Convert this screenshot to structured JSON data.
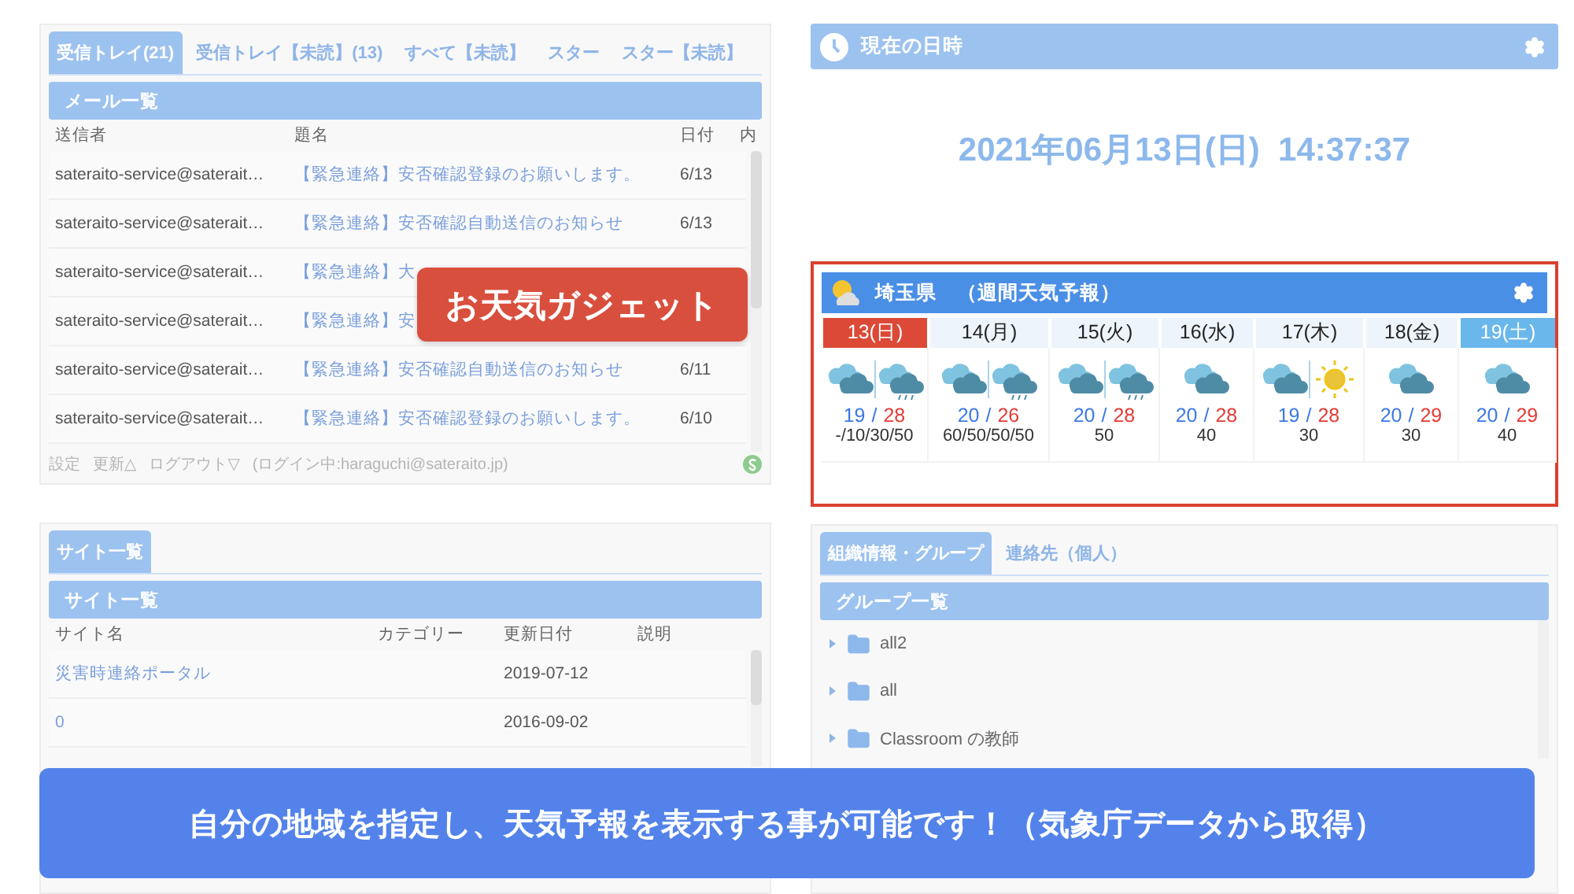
{
  "mail_panel": {
    "tabs": [
      {
        "label": "受信トレイ(21)",
        "selected": true
      },
      {
        "label": "受信トレイ【未読】(13)",
        "selected": false
      },
      {
        "label": "すべて【未読】",
        "selected": false
      },
      {
        "label": "スター",
        "selected": false
      },
      {
        "label": "スター【未読】",
        "selected": false
      }
    ],
    "header": "メール一覧",
    "columns": [
      "送信者",
      "題名",
      "日付",
      "内"
    ],
    "rows": [
      {
        "sender": "sateraito-service@saterait…",
        "subject": "【緊急連絡】安否確認登録のお願いします。",
        "date": "6/13"
      },
      {
        "sender": "sateraito-service@saterait…",
        "subject": "【緊急連絡】安否確認自動送信のお知らせ",
        "date": "6/13"
      },
      {
        "sender": "sateraito-service@saterait…",
        "subject": "【緊急連絡】大"
      },
      {
        "sender": "sateraito-service@saterait…",
        "subject": "【緊急連絡】安"
      },
      {
        "sender": "sateraito-service@saterait…",
        "subject": "【緊急連絡】安否確認自動送信のお知らせ",
        "date": "6/11"
      },
      {
        "sender": "sateraito-service@saterait…",
        "subject": "【緊急連絡】安否確認登録のお願いします。",
        "date": "6/10"
      }
    ],
    "footer": {
      "links": [
        "設定",
        "更新△",
        "ログアウト▽"
      ],
      "login": "(ログイン中:haraguchi@sateraito.jp)"
    }
  },
  "callout": "お天気ガジェット",
  "site_panel": {
    "tabs": [
      {
        "label": "サイト一覧",
        "selected": true
      }
    ],
    "header": "サイト一覧",
    "columns": [
      "サイト名",
      "カテゴリー",
      "更新日付",
      "説明"
    ],
    "rows": [
      {
        "name": "災害時連絡ポータル",
        "date": "2019-07-12"
      },
      {
        "name": "0",
        "date": "2016-09-02"
      }
    ]
  },
  "clock": {
    "title": "現在の日時",
    "datetime": "2021年06月13日(日)  14:37:37"
  },
  "weather": {
    "title": "埼玉県　（週間天気予報）",
    "days": [
      {
        "label": "13(日)",
        "color": "#dc4a37",
        "kind": "cloudy-then-rain",
        "temperature": {
          "low": "19",
          "divider": "/",
          "high": "28"
        },
        "rain_chance": "-/10/30/50"
      },
      {
        "label": "14(月)",
        "color": "#eef4fc",
        "kind": "cloudy-then-rain",
        "temperature": {
          "low": "20",
          "divider": "/",
          "high": "26"
        },
        "rain_chance": "60/50/50/50"
      },
      {
        "label": "15(火)",
        "color": "#eef4fc",
        "kind": "cloudy-then-rain",
        "temperature": {
          "low": "20",
          "divider": "/",
          "high": "28"
        },
        "rain_chance": "50"
      },
      {
        "label": "16(水)",
        "color": "#eef4fc",
        "kind": "cloudy",
        "temperature": {
          "low": "20",
          "divider": "/",
          "high": "28"
        },
        "rain_chance": "40"
      },
      {
        "label": "17(木)",
        "color": "#eef4fc",
        "kind": "cloudy-then-sunny",
        "temperature": {
          "low": "19",
          "divider": "/",
          "high": "28"
        },
        "rain_chance": "30"
      },
      {
        "label": "18(金)",
        "color": "#eef4fc",
        "kind": "cloudy",
        "temperature": {
          "low": "20",
          "divider": "/",
          "high": "29"
        },
        "rain_chance": "30"
      },
      {
        "label": "19(土)",
        "color": "#6ab7ec",
        "kind": "cloudy",
        "temperature": {
          "low": "20",
          "divider": "/",
          "high": "29"
        },
        "rain_chance": "40"
      }
    ]
  },
  "group_panel": {
    "tabs": [
      {
        "label": "組織情報・グループ",
        "selected": true
      },
      {
        "label": "連絡先（個人）",
        "selected": false
      }
    ],
    "header": "グループ一覧",
    "groups": [
      {
        "name": "all2",
        "expanded": false
      },
      {
        "name": "all",
        "expanded": false
      },
      {
        "name": "Classroom の教師",
        "expanded": false
      }
    ]
  },
  "banner": "自分の地域を指定し、天気予報を表示する事が可能です！（気象庁データから取得）"
}
